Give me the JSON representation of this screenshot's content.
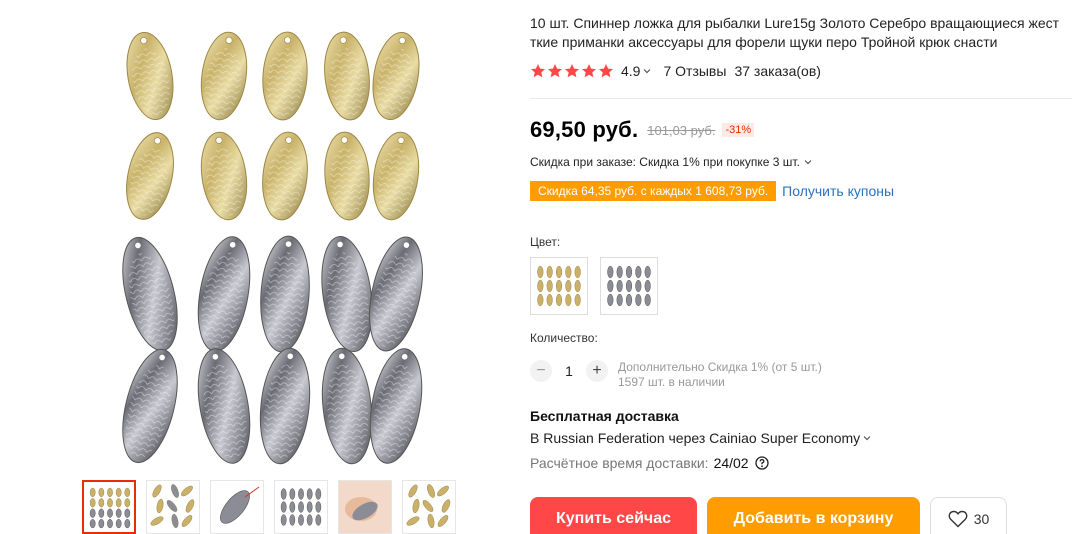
{
  "product": {
    "title_line1": "10 шт. Спиннер ложка для рыбалки Lure15g Золото Серебро вращающиеся жест",
    "title_line2": "ткие приманки аксессуары для форели щуки перо Тройной крюк снасти",
    "rating": "4.9",
    "stars": 5,
    "reviews": "7 Отзывы",
    "orders": "37 заказа(ов)"
  },
  "price": {
    "current": "69,50 руб.",
    "old": "101,03 руб.",
    "discount": "-31%",
    "order_discount": "Скидка при заказе: Скидка 1% при покупке 3 шт.",
    "coupon_badge": "Скидка 64,35 руб. с каждых 1 608,73 руб.",
    "coupon_link": "Получить купоны"
  },
  "options": {
    "color_label": "Цвет:",
    "colors": [
      "gold",
      "silver"
    ],
    "quantity_label": "Количество:",
    "quantity": "1",
    "minus": "−",
    "plus": "+",
    "extra_discount": "Дополнительно Скидка 1% (от 5 шт.)",
    "stock": "1597 шт. в наличии"
  },
  "shipping": {
    "title": "Бесплатная доставка",
    "method": "В Russian Federation через Cainiao Super Economy",
    "eta_label": "Расчётное время доставки:",
    "eta_value": "24/02"
  },
  "actions": {
    "buy": "Купить сейчас",
    "cart": "Добавить в корзину",
    "wishlist_count": "30"
  },
  "gallery": {
    "thumbnail_count": 6,
    "active_thumbnail": 0
  },
  "colors": {
    "accent_red": "#ff4747",
    "accent_orange": "#ff9c00",
    "star": "#ff4747",
    "link": "#2e72b8",
    "gold": "#cbb06a",
    "silver": "#8c8c96"
  }
}
